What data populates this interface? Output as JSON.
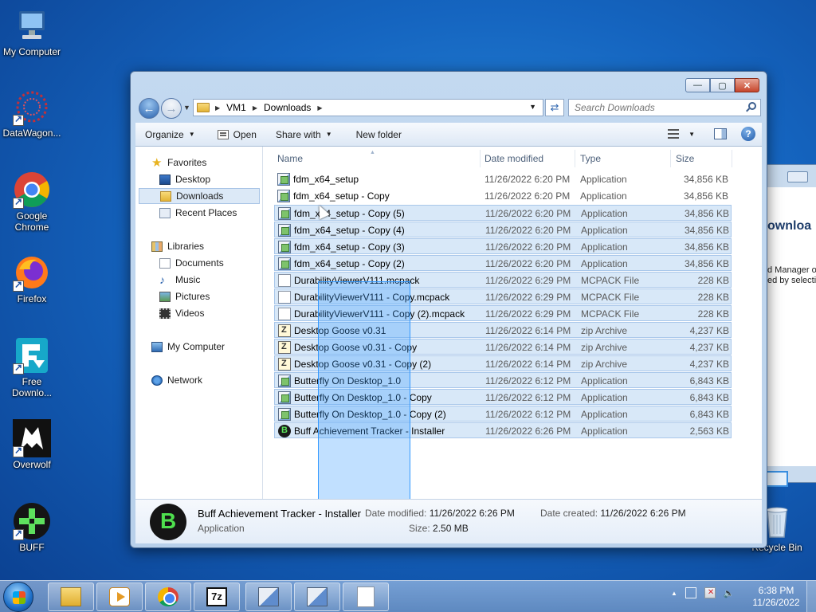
{
  "desktop": {
    "icons": [
      {
        "label": "My Computer"
      },
      {
        "label": "DataWagon..."
      },
      {
        "label": "Google Chrome"
      },
      {
        "label": "Firefox"
      },
      {
        "label": "Free Downlo..."
      },
      {
        "label": "Overwolf"
      },
      {
        "label": "BUFF"
      },
      {
        "label": "Recycle Bin"
      }
    ]
  },
  "background_window": {
    "title_fragment": "ownloa",
    "text_line1": "d Manager o",
    "text_line2": "ed by selecti"
  },
  "window": {
    "controls": {
      "minimize": "—",
      "maximize": "▢",
      "close": "✕"
    },
    "address": {
      "crumbs": [
        "VM1",
        "Downloads"
      ]
    },
    "search": {
      "placeholder": "Search Downloads"
    },
    "toolbar": {
      "organize": "Organize",
      "open": "Open",
      "share_with": "Share with",
      "new_folder": "New folder"
    },
    "nav": {
      "favorites": "Favorites",
      "desktop": "Desktop",
      "downloads": "Downloads",
      "recent_places": "Recent Places",
      "libraries": "Libraries",
      "documents": "Documents",
      "music": "Music",
      "pictures": "Pictures",
      "videos": "Videos",
      "my_computer": "My Computer",
      "network": "Network"
    },
    "columns": {
      "name": "Name",
      "date": "Date modified",
      "type": "Type",
      "size": "Size"
    },
    "files": [
      {
        "name": "fdm_x64_setup",
        "date": "11/26/2022 6:20 PM",
        "type": "Application",
        "size": "34,856 KB",
        "icon": "app-icon",
        "selected": false
      },
      {
        "name": "fdm_x64_setup - Copy",
        "date": "11/26/2022 6:20 PM",
        "type": "Application",
        "size": "34,856 KB",
        "icon": "app-icon",
        "selected": false
      },
      {
        "name": "fdm_x64_setup - Copy (5)",
        "date": "11/26/2022 6:20 PM",
        "type": "Application",
        "size": "34,856 KB",
        "icon": "app-icon",
        "selected": true
      },
      {
        "name": "fdm_x64_setup - Copy (4)",
        "date": "11/26/2022 6:20 PM",
        "type": "Application",
        "size": "34,856 KB",
        "icon": "app-icon",
        "selected": true
      },
      {
        "name": "fdm_x64_setup - Copy (3)",
        "date": "11/26/2022 6:20 PM",
        "type": "Application",
        "size": "34,856 KB",
        "icon": "app-icon",
        "selected": true
      },
      {
        "name": "fdm_x64_setup - Copy (2)",
        "date": "11/26/2022 6:20 PM",
        "type": "Application",
        "size": "34,856 KB",
        "icon": "app-icon",
        "selected": true
      },
      {
        "name": "DurabilityViewerV111.mcpack",
        "date": "11/26/2022 6:29 PM",
        "type": "MCPACK File",
        "size": "228 KB",
        "icon": "document-icon",
        "selected": true
      },
      {
        "name": "DurabilityViewerV111 - Copy.mcpack",
        "date": "11/26/2022 6:29 PM",
        "type": "MCPACK File",
        "size": "228 KB",
        "icon": "document-icon",
        "selected": true
      },
      {
        "name": "DurabilityViewerV111 - Copy (2).mcpack",
        "date": "11/26/2022 6:29 PM",
        "type": "MCPACK File",
        "size": "228 KB",
        "icon": "document-icon",
        "selected": true
      },
      {
        "name": "Desktop Goose v0.31",
        "date": "11/26/2022 6:14 PM",
        "type": "zip Archive",
        "size": "4,237 KB",
        "icon": "zip-icon",
        "selected": true
      },
      {
        "name": "Desktop Goose v0.31 - Copy",
        "date": "11/26/2022 6:14 PM",
        "type": "zip Archive",
        "size": "4,237 KB",
        "icon": "zip-icon",
        "selected": true
      },
      {
        "name": "Desktop Goose v0.31 - Copy (2)",
        "date": "11/26/2022 6:14 PM",
        "type": "zip Archive",
        "size": "4,237 KB",
        "icon": "zip-icon",
        "selected": true
      },
      {
        "name": "Butterfly On Desktop_1.0",
        "date": "11/26/2022 6:12 PM",
        "type": "Application",
        "size": "6,843 KB",
        "icon": "app-icon",
        "selected": true
      },
      {
        "name": "Butterfly On Desktop_1.0 - Copy",
        "date": "11/26/2022 6:12 PM",
        "type": "Application",
        "size": "6,843 KB",
        "icon": "app-icon",
        "selected": true
      },
      {
        "name": "Butterfly On Desktop_1.0 - Copy (2)",
        "date": "11/26/2022 6:12 PM",
        "type": "Application",
        "size": "6,843 KB",
        "icon": "app-icon",
        "selected": true
      },
      {
        "name": "Buff Achievement Tracker - Installer",
        "date": "11/26/2022 6:26 PM",
        "type": "Application",
        "size": "2,563 KB",
        "icon": "buff-icon",
        "selected": true
      }
    ],
    "details": {
      "name": "Buff Achievement Tracker - Installer",
      "type": "Application",
      "modified_label": "Date modified:",
      "modified": "11/26/2022 6:26 PM",
      "size_label": "Size:",
      "size": "2.50 MB",
      "created_label": "Date created:",
      "created": "11/26/2022 6:26 PM"
    }
  },
  "taskbar": {
    "clock_time": "6:38 PM",
    "clock_date": "11/26/2022",
    "apps": [
      "windows-explorer",
      "media-player",
      "google-chrome",
      "7-zip",
      "setup",
      "setup",
      "notepad"
    ]
  }
}
